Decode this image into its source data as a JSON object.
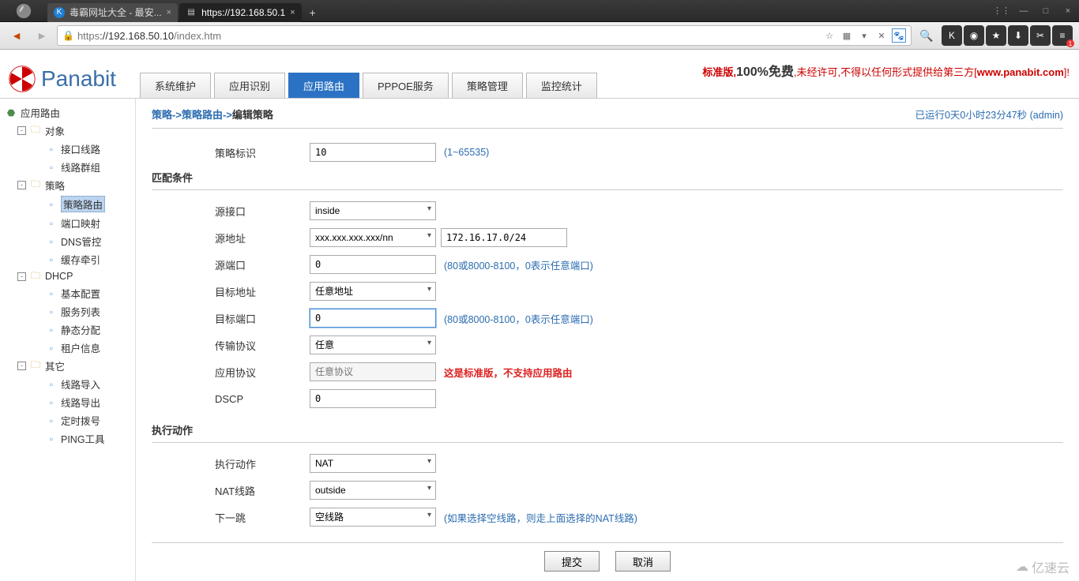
{
  "browser": {
    "tabs": [
      {
        "label": "毒霸网址大全 - 最安...",
        "active": false
      },
      {
        "label": "https://192.168.50.1",
        "active": true
      }
    ],
    "url_scheme": "https",
    "url_host": "://192.168.50.10",
    "url_path": "/index.htm"
  },
  "brand": {
    "name": "Panabit"
  },
  "main_tabs": [
    {
      "label": "系统维护"
    },
    {
      "label": "应用识别"
    },
    {
      "label": "应用路由",
      "active": true
    },
    {
      "label": "PPPOE服务"
    },
    {
      "label": "策略管理"
    },
    {
      "label": "监控统计"
    }
  ],
  "header_right": {
    "t1": "标准版,",
    "t2": "100%免费",
    "t3": ",未经许可,不得以任何形式提供给第三方[",
    "link": "www.panabit.com",
    "t4": "]!"
  },
  "sidebar": {
    "root": "应用路由",
    "nodes": [
      {
        "label": "对象",
        "type": "folder",
        "level": 2,
        "exp": "-"
      },
      {
        "label": "接口线路",
        "type": "page",
        "level": 3
      },
      {
        "label": "线路群组",
        "type": "page",
        "level": 3
      },
      {
        "label": "策略",
        "type": "folder",
        "level": 2,
        "exp": "-"
      },
      {
        "label": "策略路由",
        "type": "page",
        "level": 3,
        "selected": true
      },
      {
        "label": "端口映射",
        "type": "page",
        "level": 3
      },
      {
        "label": "DNS管控",
        "type": "page",
        "level": 3
      },
      {
        "label": "缓存牵引",
        "type": "page",
        "level": 3
      },
      {
        "label": "DHCP",
        "type": "folder",
        "level": 2,
        "exp": "-"
      },
      {
        "label": "基本配置",
        "type": "page",
        "level": 3
      },
      {
        "label": "服务列表",
        "type": "page",
        "level": 3
      },
      {
        "label": "静态分配",
        "type": "page",
        "level": 3
      },
      {
        "label": "租户信息",
        "type": "page",
        "level": 3
      },
      {
        "label": "其它",
        "type": "folder",
        "level": 2,
        "exp": "-"
      },
      {
        "label": "线路导入",
        "type": "page",
        "level": 3
      },
      {
        "label": "线路导出",
        "type": "page",
        "level": 3
      },
      {
        "label": "定时拨号",
        "type": "page",
        "level": 3
      },
      {
        "label": "PING工具",
        "type": "page",
        "level": 3
      }
    ]
  },
  "breadcrumb": {
    "p1": "策略",
    "p2": "策略路由",
    "p3": "编辑策略"
  },
  "runtime": "已运行0天0小时23分47秒 (admin)",
  "form": {
    "policy_id": {
      "label": "策略标识",
      "value": "10",
      "hint": "(1~65535)"
    },
    "sec_match": "匹配条件",
    "src_if": {
      "label": "源接口",
      "value": "inside"
    },
    "src_addr": {
      "label": "源地址",
      "value": "xxx.xxx.xxx.xxx/nn",
      "value2": "172.16.17.0/24"
    },
    "src_port": {
      "label": "源端口",
      "value": "0",
      "hint": "(80或8000-8100，0表示任意端口)"
    },
    "dst_addr": {
      "label": "目标地址",
      "value": "任意地址"
    },
    "dst_port": {
      "label": "目标端口",
      "value": "0",
      "hint": "(80或8000-8100，0表示任意端口)"
    },
    "proto": {
      "label": "传输协议",
      "value": "任意"
    },
    "app_proto": {
      "label": "应用协议",
      "placeholder": "任意协议",
      "hint": "这是标准版，不支持应用路由"
    },
    "dscp": {
      "label": "DSCP",
      "value": "0"
    },
    "sec_action": "执行动作",
    "action": {
      "label": "执行动作",
      "value": "NAT"
    },
    "nat_line": {
      "label": "NAT线路",
      "value": "outside"
    },
    "next_hop": {
      "label": "下一跳",
      "value": "空线路",
      "hint": "(如果选择空线路，则走上面选择的NAT线路)"
    },
    "submit": "提交",
    "cancel": "取消"
  },
  "watermark": "亿速云"
}
